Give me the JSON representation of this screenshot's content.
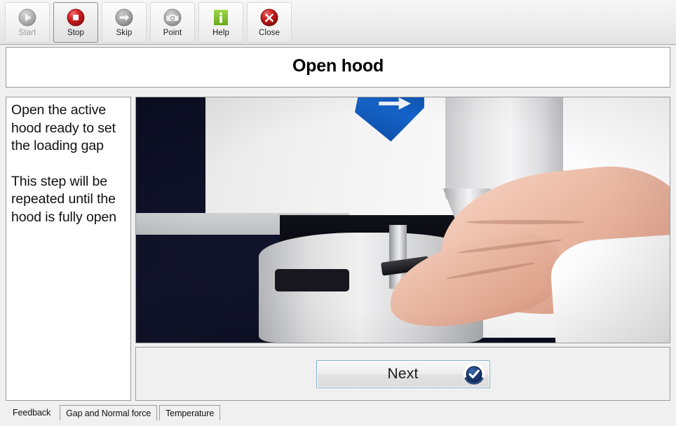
{
  "toolbar": {
    "buttons": [
      {
        "label": "Start",
        "icon": "play-circle-icon",
        "state": "disabled"
      },
      {
        "label": "Stop",
        "icon": "stop-circle-icon",
        "state": "focused"
      },
      {
        "label": "Skip",
        "icon": "arrow-right-circle-icon",
        "state": "normal"
      },
      {
        "label": "Point",
        "icon": "camera-icon",
        "state": "normal"
      },
      {
        "label": "Help",
        "icon": "info-square-icon",
        "state": "normal"
      },
      {
        "label": "Close",
        "icon": "close-circle-icon",
        "state": "normal"
      }
    ]
  },
  "header": {
    "title": "Open hood"
  },
  "instructions": {
    "paragraph1": "Open the active hood ready to set the loading gap",
    "paragraph2": "This step will be repeated until the hood is fully open"
  },
  "media": {
    "alt": "Photograph of a hand opening the active hood of a rheometer instrument"
  },
  "actions": {
    "next_label": "Next",
    "next_icon": "check-circle-icon"
  },
  "tabs": [
    {
      "label": "Feedback",
      "active": true
    },
    {
      "label": "Gap and Normal force",
      "active": false
    },
    {
      "label": "Temperature",
      "active": false
    }
  ],
  "colors": {
    "accent_blue": "#1b3e78",
    "stop_red": "#cc1f1f",
    "help_green": "#7cba2b",
    "close_red": "#c01c1c",
    "panel_bg": "#f0f0f0",
    "border": "#9a9a9a"
  }
}
